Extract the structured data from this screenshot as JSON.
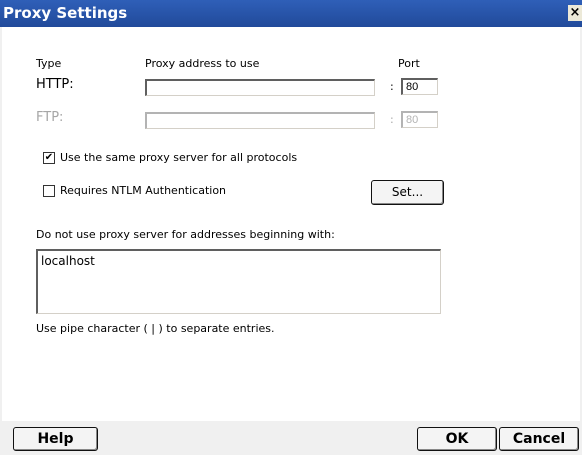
{
  "window": {
    "title": "Proxy Settings",
    "close_glyph": "×"
  },
  "columns": {
    "type": "Type",
    "address": "Proxy address to use",
    "port": "Port"
  },
  "http": {
    "label": "HTTP:",
    "address": "",
    "port": "80"
  },
  "ftp": {
    "label": "FTP:",
    "address": "",
    "port": "80"
  },
  "separator": ":",
  "options": {
    "same_proxy": {
      "label": "Use the same proxy server for all protocols",
      "checked": true
    },
    "ntlm": {
      "label": "Requires NTLM Authentication",
      "checked": false
    },
    "set_button": "Set..."
  },
  "exclusions": {
    "label": "Do not use proxy server for addresses beginning with:",
    "value": "localhost",
    "hint": "Use pipe character ( | ) to separate entries."
  },
  "buttons": {
    "help": "Help",
    "ok": "OK",
    "cancel": "Cancel"
  },
  "colors": {
    "titlebar": "#2f5fb8"
  }
}
